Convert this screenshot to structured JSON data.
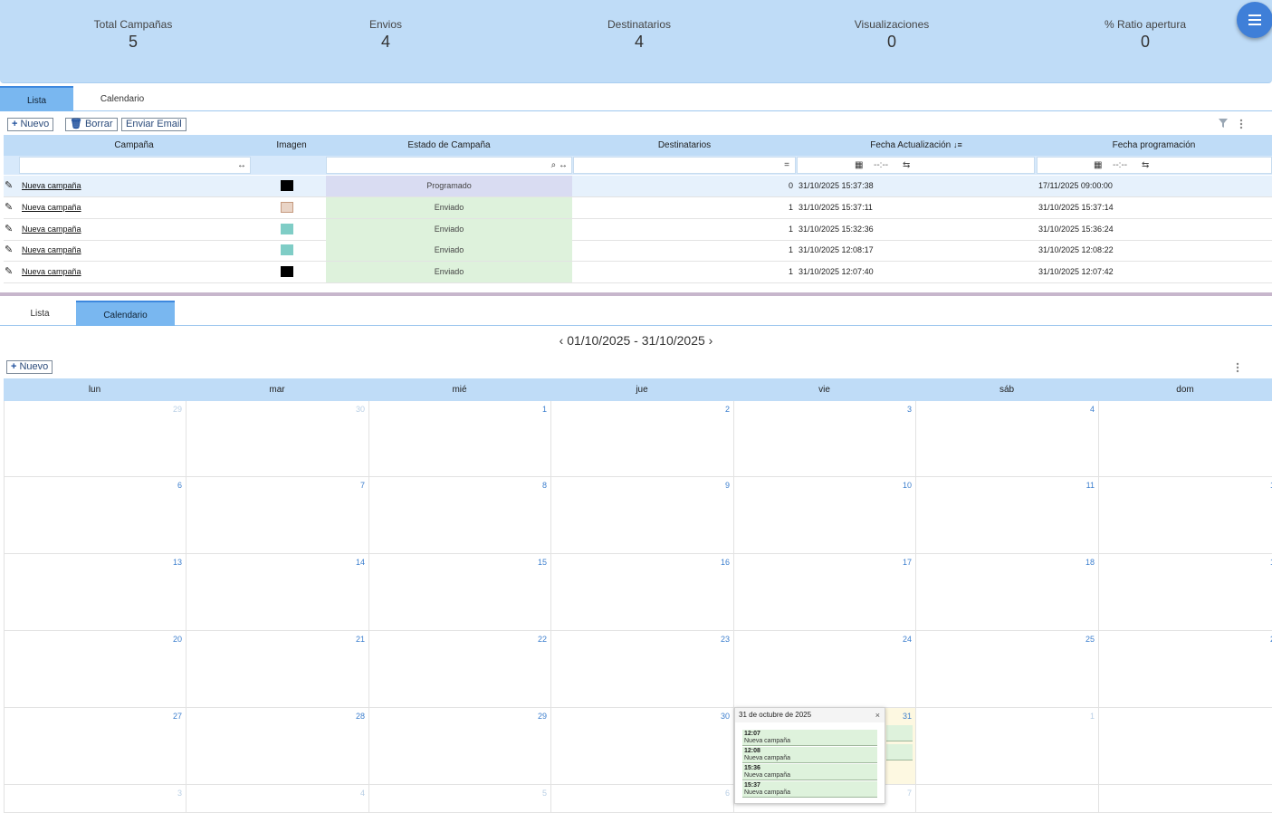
{
  "stats": [
    {
      "label": "Total Campañas",
      "value": "5"
    },
    {
      "label": "Envios",
      "value": "4"
    },
    {
      "label": "Destinatarios",
      "value": "4"
    },
    {
      "label": "Visualizaciones",
      "value": "0"
    },
    {
      "label": "% Ratio apertura",
      "value": "0"
    }
  ],
  "tabs": {
    "list": "Lista",
    "calendar": "Calendario"
  },
  "toolbar": {
    "new": "Nuevo",
    "delete": "Borrar",
    "send": "Enviar Email"
  },
  "grid": {
    "columns": [
      "Campaña",
      "Imagen",
      "Estado de Campaña",
      "Destinatarios",
      "Fecha Actualización",
      "Fecha programación"
    ],
    "filter": {
      "equals": "=",
      "date_placeholder": "--:--"
    },
    "rows": [
      {
        "name": "Nueva campaña",
        "status": "Programado",
        "recipients": "0",
        "updated": "31/10/2025 15:37:38",
        "scheduled": "17/11/2025 09:00:00"
      },
      {
        "name": "Nueva campaña",
        "status": "Enviado",
        "recipients": "1",
        "updated": "31/10/2025 15:37:11",
        "scheduled": "31/10/2025 15:37:14"
      },
      {
        "name": "Nueva campaña",
        "status": "Enviado",
        "recipients": "1",
        "updated": "31/10/2025 15:32:36",
        "scheduled": "31/10/2025 15:36:24"
      },
      {
        "name": "Nueva campaña",
        "status": "Enviado",
        "recipients": "1",
        "updated": "31/10/2025 12:08:17",
        "scheduled": "31/10/2025 12:08:22"
      },
      {
        "name": "Nueva campaña",
        "status": "Enviado",
        "recipients": "1",
        "updated": "31/10/2025 12:07:40",
        "scheduled": "31/10/2025 12:07:42"
      }
    ]
  },
  "calendar": {
    "range": "01/10/2025 - 31/10/2025",
    "new": "Nuevo",
    "weekdays": [
      "lun",
      "mar",
      "mié",
      "jue",
      "vie",
      "sáb",
      "dom"
    ],
    "weeks": [
      [
        "29",
        "30",
        "1",
        "2",
        "3",
        "4",
        ""
      ],
      [
        "6",
        "7",
        "8",
        "9",
        "10",
        "11",
        "1"
      ],
      [
        "13",
        "14",
        "15",
        "16",
        "17",
        "18",
        "1"
      ],
      [
        "20",
        "21",
        "22",
        "23",
        "24",
        "25",
        "2"
      ],
      [
        "27",
        "28",
        "29",
        "30",
        "",
        "31",
        "1"
      ],
      [
        "3",
        "4",
        "5",
        "6",
        "",
        "7",
        ""
      ]
    ],
    "popup": {
      "title": "31 de octubre de 2025",
      "close": "×",
      "events": [
        {
          "time": "12:07",
          "title": "Nueva campaña"
        },
        {
          "time": "12:08",
          "title": "Nueva campaña"
        },
        {
          "time": "15:36",
          "title": "Nueva campaña"
        },
        {
          "time": "15:37",
          "title": "Nueva campaña"
        }
      ]
    }
  }
}
